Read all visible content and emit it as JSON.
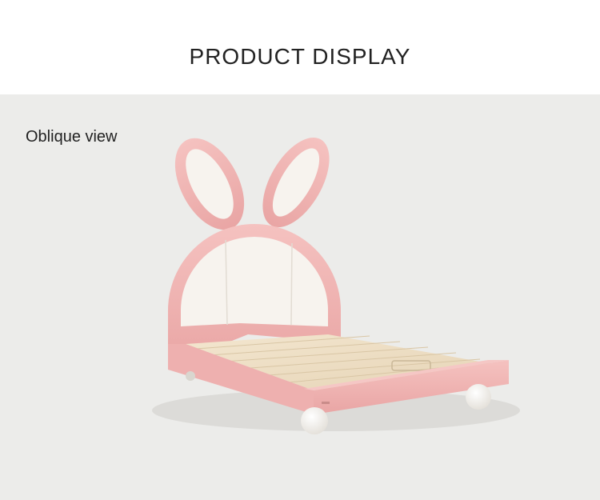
{
  "header": {
    "title": "PRODUCT DISPLAY"
  },
  "stage": {
    "view_label": "Oblique view"
  },
  "product": {
    "name": "bunny-ear-bed",
    "colors": {
      "frame": "#f2b6b4",
      "panel": "#f7f3ee",
      "slats": "#efe1c8",
      "feet": "#f8f6f2",
      "background": "#ececea"
    }
  }
}
